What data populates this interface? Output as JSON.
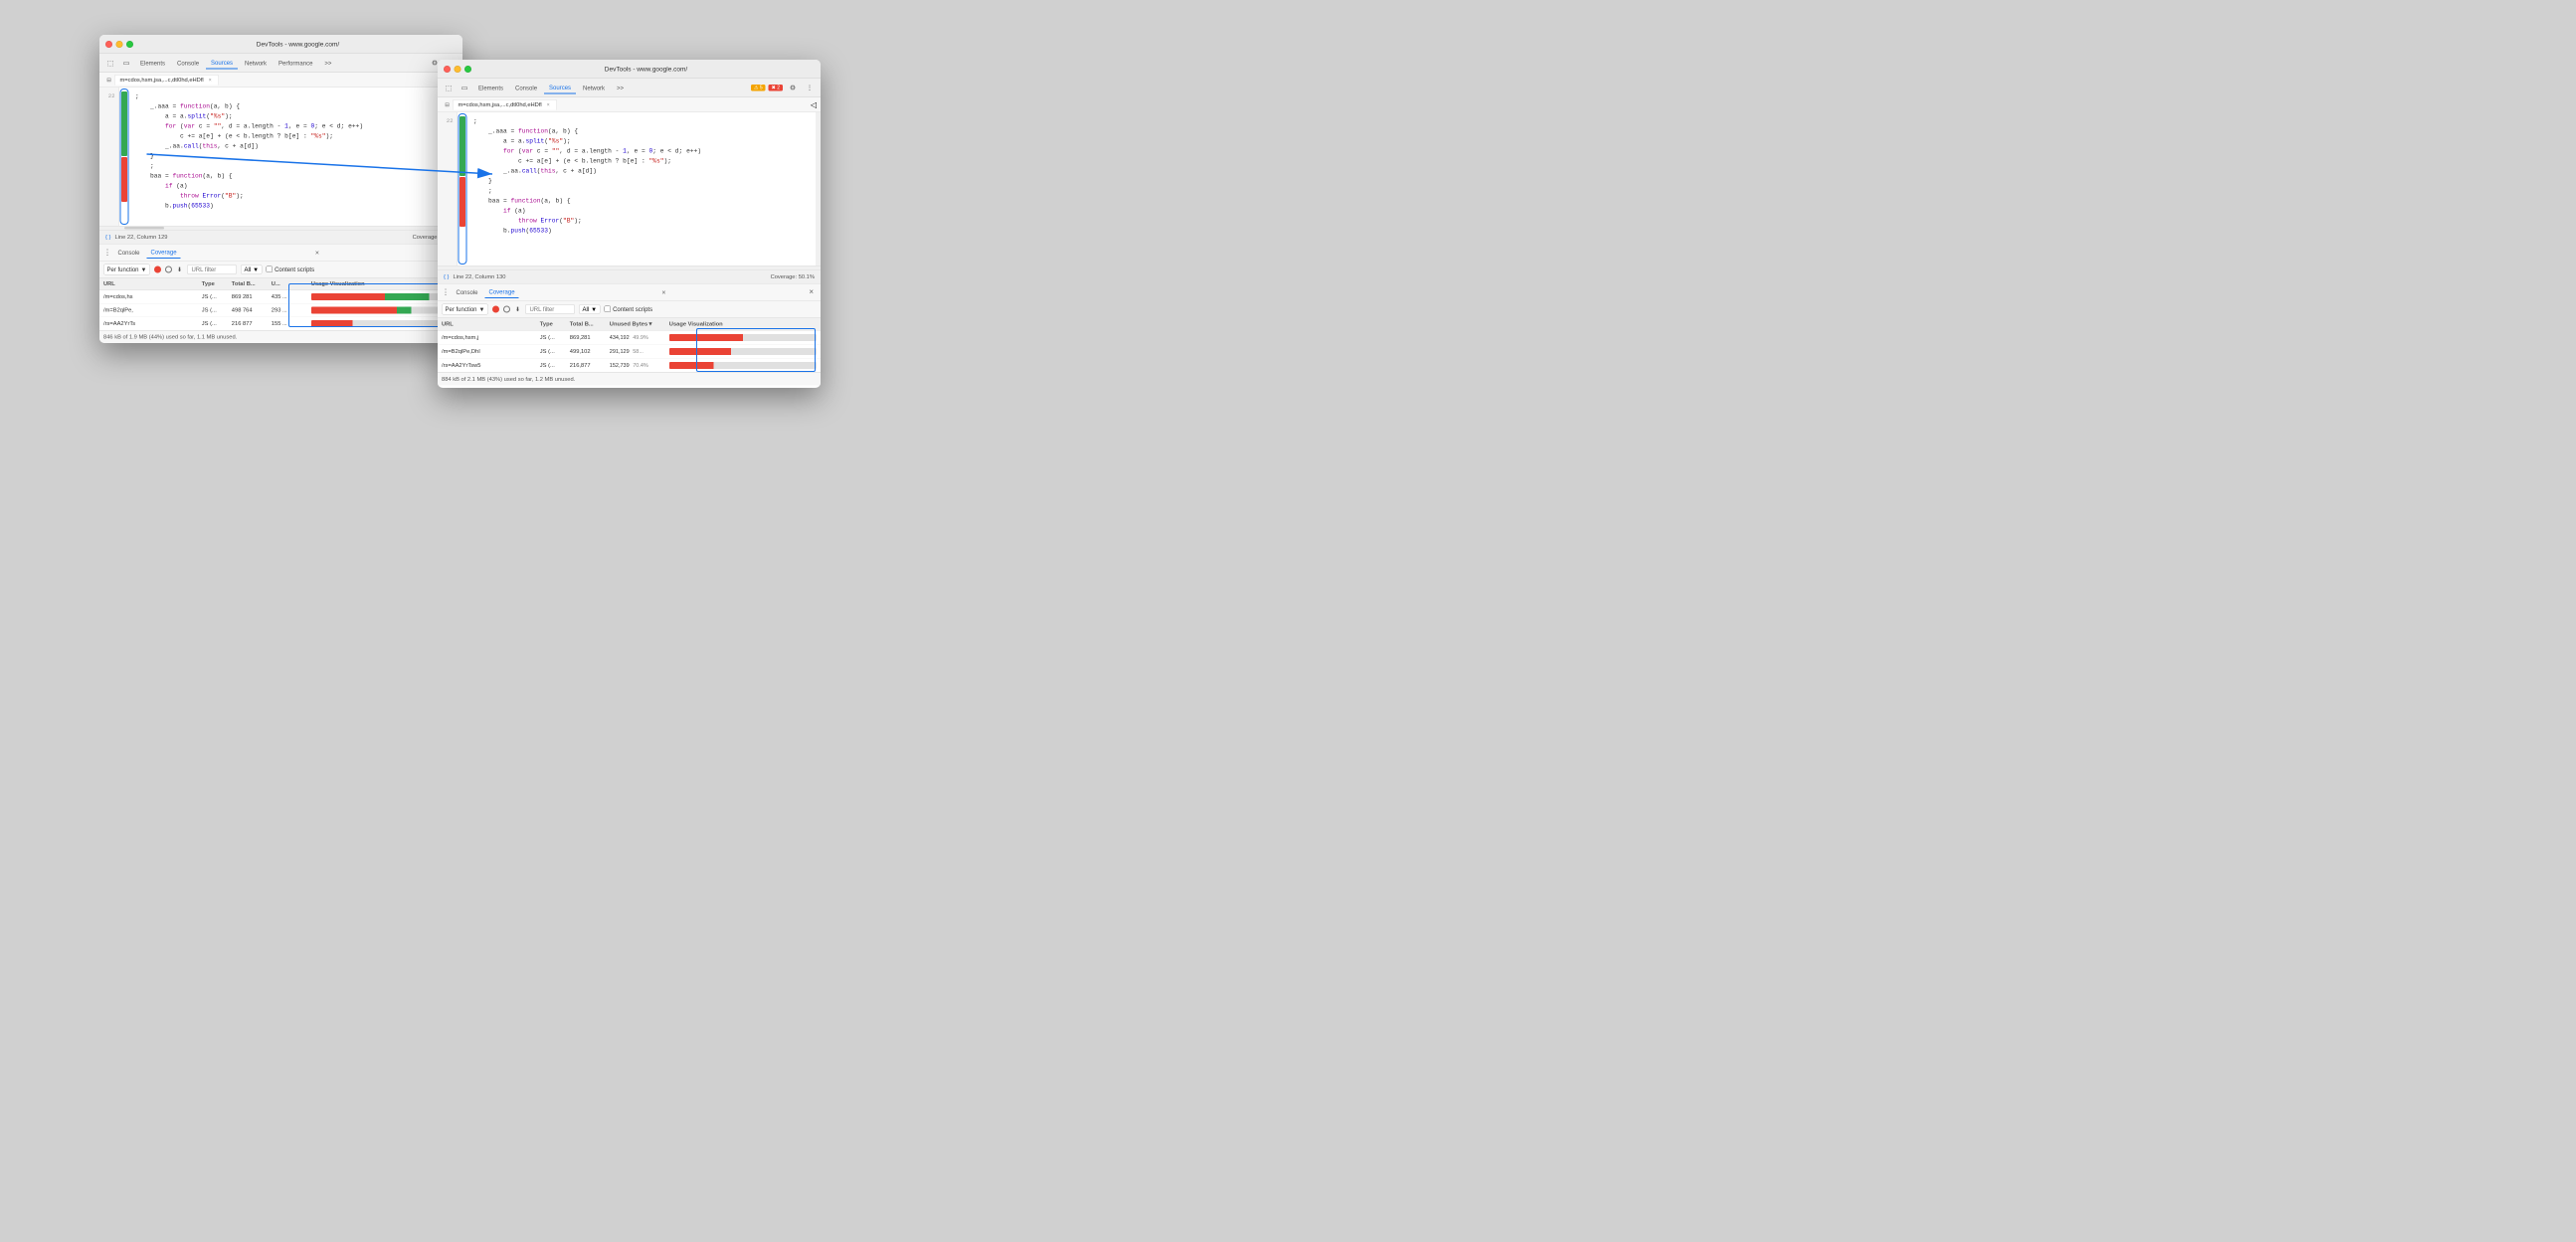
{
  "left_window": {
    "title": "DevTools - www.google.com/",
    "tabs": [
      "Elements",
      "Console",
      "Sources",
      "Network",
      "Performance",
      ">>"
    ],
    "active_tab": "Sources",
    "file_tab": "m=cdos,hsm,jsa,...c,dtl0hd,eHDfl",
    "status": {
      "line": "Line 22, Column 129",
      "coverage": "Coverage: 49.9%"
    },
    "panel": {
      "tabs": [
        "Console",
        "Coverage"
      ],
      "active_tab": "Coverage"
    },
    "coverage_toolbar": {
      "per_function": "Per function",
      "url_filter_placeholder": "URL filter",
      "all_label": "All",
      "content_scripts_label": "Content scripts"
    },
    "table": {
      "headers": [
        "URL",
        "Type",
        "Total B...",
        "U...",
        "Usage Visualization"
      ],
      "rows": [
        {
          "url": "/m=cdos,hs",
          "type": "JS (...",
          "total": "869 281",
          "unused": "435 ...",
          "used_pct": 50,
          "extra_pct": 30
        },
        {
          "url": "/m=B2qlPe,",
          "type": "JS (...",
          "total": "498 764",
          "unused": "293 ...",
          "used_pct": 58,
          "extra_pct": 10
        },
        {
          "url": "/rs=AA2YrTs",
          "type": "JS (...",
          "total": "216 877",
          "unused": "155 ...",
          "used_pct": 28,
          "extra_pct": 0
        }
      ],
      "footer": "846 kB of 1.9 MB (44%) used so far, 1.1 MB unused."
    },
    "code": {
      "lines": [
        "22",
        "",
        "",
        "",
        "",
        "",
        "",
        "",
        "",
        "",
        "",
        ""
      ]
    }
  },
  "right_window": {
    "title": "DevTools - www.google.com/",
    "tabs": [
      "Elements",
      "Console",
      "Sources",
      "Network",
      ">>"
    ],
    "active_tab": "Sources",
    "file_tab": "m=cdos,hsm,jsa,...c,dtl0hd,eHDfl",
    "warnings": "5",
    "errors": "2",
    "status": {
      "line": "Line 22, Column 130",
      "coverage": "Coverage: 50.1%"
    },
    "panel": {
      "tabs": [
        "Console",
        "Coverage"
      ],
      "active_tab": "Coverage"
    },
    "coverage_toolbar": {
      "per_function": "Per function",
      "url_filter_placeholder": "URL filter",
      "all_label": "All",
      "content_scripts_label": "Content scripts"
    },
    "table": {
      "headers": [
        "URL",
        "Type",
        "Total B...",
        "Unused Bytes▼",
        "Usage Visualization"
      ],
      "rows": [
        {
          "url": "/m=cdos,hsm,j",
          "type": "JS (...",
          "total": "869,281",
          "unused": "434,192",
          "unused_pct": "49.9%",
          "used_pct": 50,
          "extra_pct": 0
        },
        {
          "url": "/m=B2qlPe,DhI",
          "type": "JS (...",
          "total": "499,102",
          "unused": "291,129",
          "unused_pct": "58...",
          "used_pct": 42,
          "extra_pct": 0
        },
        {
          "url": "/rs=AA2YrTsw5",
          "type": "JS (...",
          "total": "216,877",
          "unused": "152,739",
          "unused_pct": "70.4%",
          "used_pct": 30,
          "extra_pct": 0
        }
      ],
      "footer": "884 kB of 2.1 MB (43%) used so far, 1.2 MB unused."
    }
  },
  "icons": {
    "cursor": "⬚",
    "panel_toggle": "⊞",
    "dots": "⋮",
    "gear": "⚙",
    "chevron": "▼",
    "close": "×",
    "download": "⬇",
    "brackets": "{ }",
    "sidebar_toggle": "⊟"
  }
}
